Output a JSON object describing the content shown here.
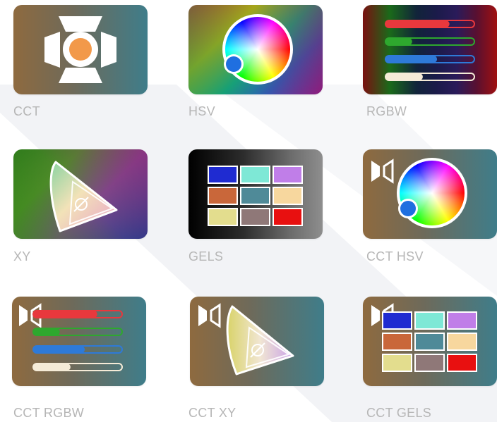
{
  "modes": [
    {
      "id": "cct",
      "label": "CCT"
    },
    {
      "id": "hsv",
      "label": "HSV"
    },
    {
      "id": "rgbw",
      "label": "RGBW"
    },
    {
      "id": "xy",
      "label": "XY"
    },
    {
      "id": "gels",
      "label": "GELS"
    },
    {
      "id": "cct-hsv",
      "label": "CCT HSV"
    },
    {
      "id": "cct-rgbw",
      "label": "CCT RGBW"
    },
    {
      "id": "cct-xy",
      "label": "CCT XY"
    },
    {
      "id": "cct-gels",
      "label": "CCT GELS"
    }
  ],
  "rgbw_levels": {
    "red": 0.72,
    "green": 0.3,
    "blue": 0.58,
    "white": 0.42
  },
  "gel_colors": [
    "#1f2bd1",
    "#7ee8d6",
    "#c07ee8",
    "#c9673a",
    "#4f8a98",
    "#f7d79e",
    "#e3dd8e",
    "#8f7878",
    "#e81010"
  ],
  "colors": {
    "label": "#b6b6b6",
    "accent_blue": "#1f6fe0",
    "cct_dot": "#f2994a",
    "red": "#e8383d",
    "green": "#2ea82e",
    "blue": "#2e7ad8",
    "white": "#f5ebd7"
  },
  "icons": {
    "cct": "barn-door-light-icon",
    "hsv": "color-wheel-icon",
    "rgbw": "rgbw-sliders-icon",
    "xy": "cie-diagram-icon",
    "gels": "gel-swatches-icon",
    "cct_marker": "barn-door-small-icon"
  }
}
